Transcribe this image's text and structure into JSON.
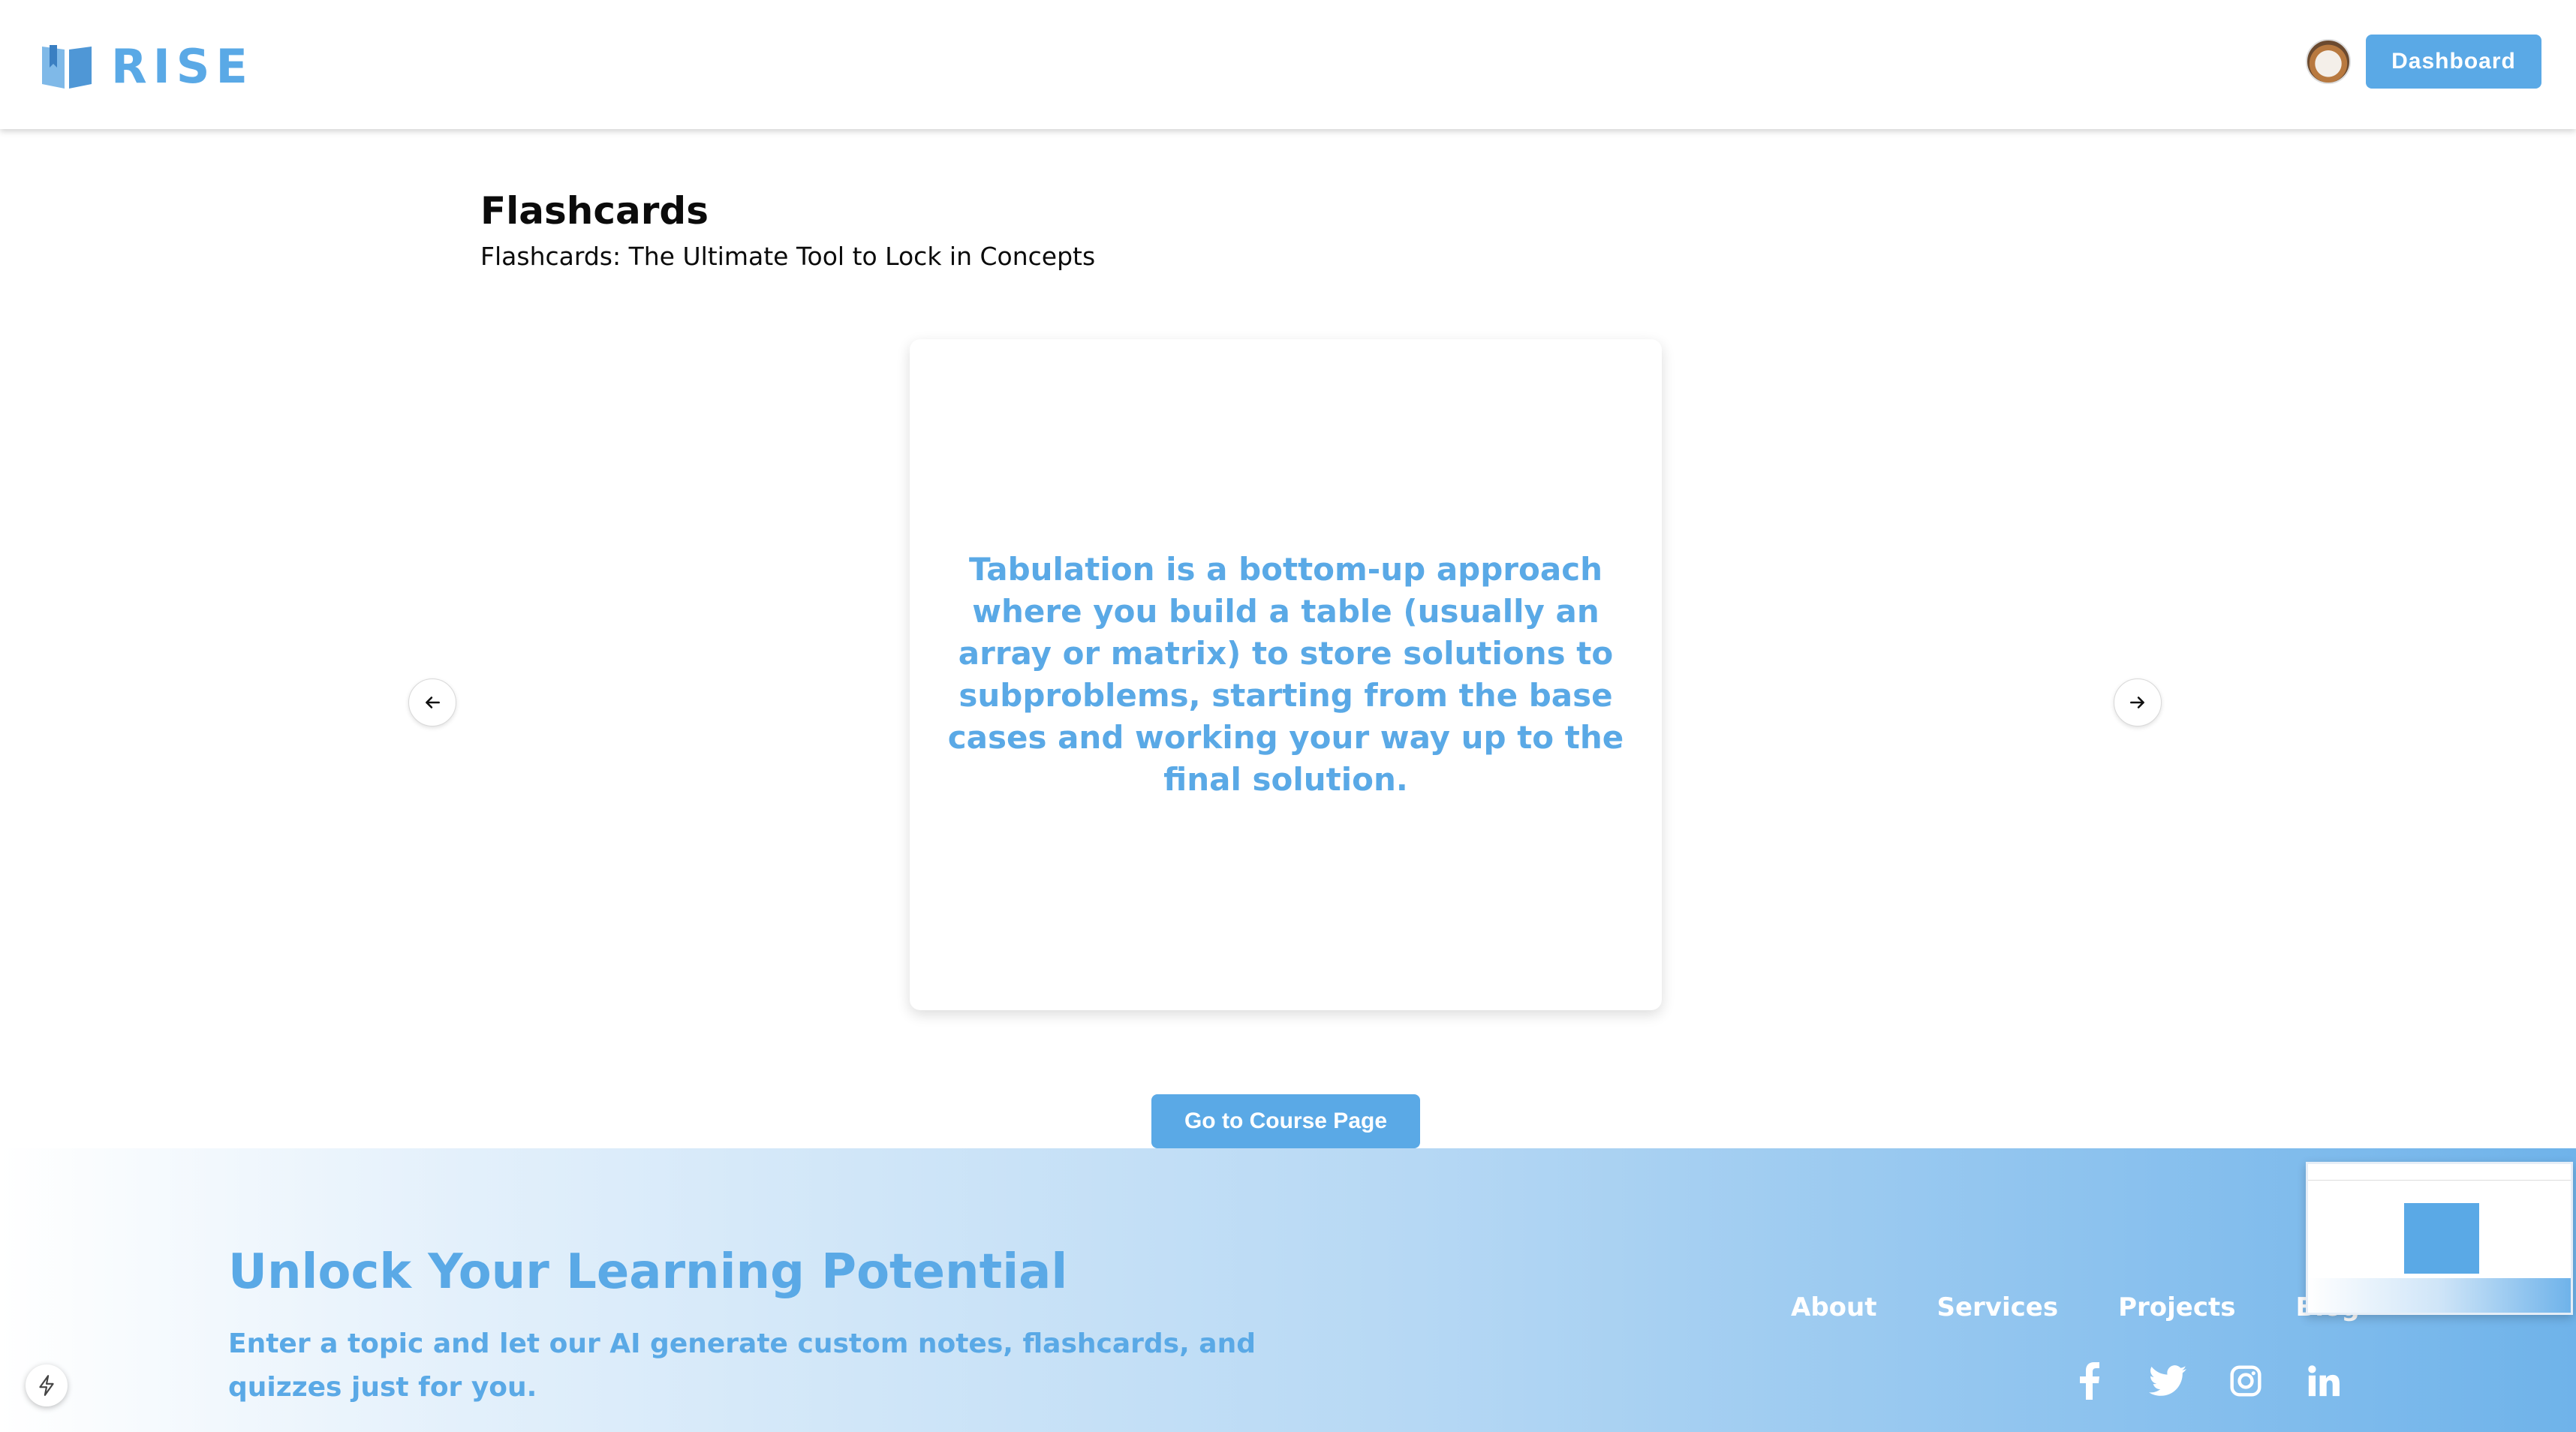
{
  "header": {
    "logo_text": "RISE",
    "dashboard_label": "Dashboard"
  },
  "page": {
    "title": "Flashcards",
    "subtitle": "Flashcards: The Ultimate Tool to Lock in Concepts"
  },
  "flashcard": {
    "text": "Tabulation is a bottom-up approach where you build a table (usually an array or matrix) to store solutions to subproblems, starting from the base cases and working your way up to the final solution.",
    "prev_icon": "arrow-left-icon",
    "next_icon": "arrow-right-icon"
  },
  "course_button_label": "Go to Course Page",
  "footer": {
    "title": "Unlock Your Learning Potential",
    "description": "Enter a topic and let our AI generate custom notes, flashcards, and quizzes just for you.",
    "links": [
      "About",
      "Services",
      "Projects",
      "Blog"
    ],
    "social_icons": [
      "facebook-icon",
      "twitter-icon",
      "instagram-icon",
      "linkedin-icon"
    ]
  },
  "colors": {
    "accent": "#5aa9e6",
    "text_dark": "#0b0b0b",
    "white": "#ffffff"
  }
}
